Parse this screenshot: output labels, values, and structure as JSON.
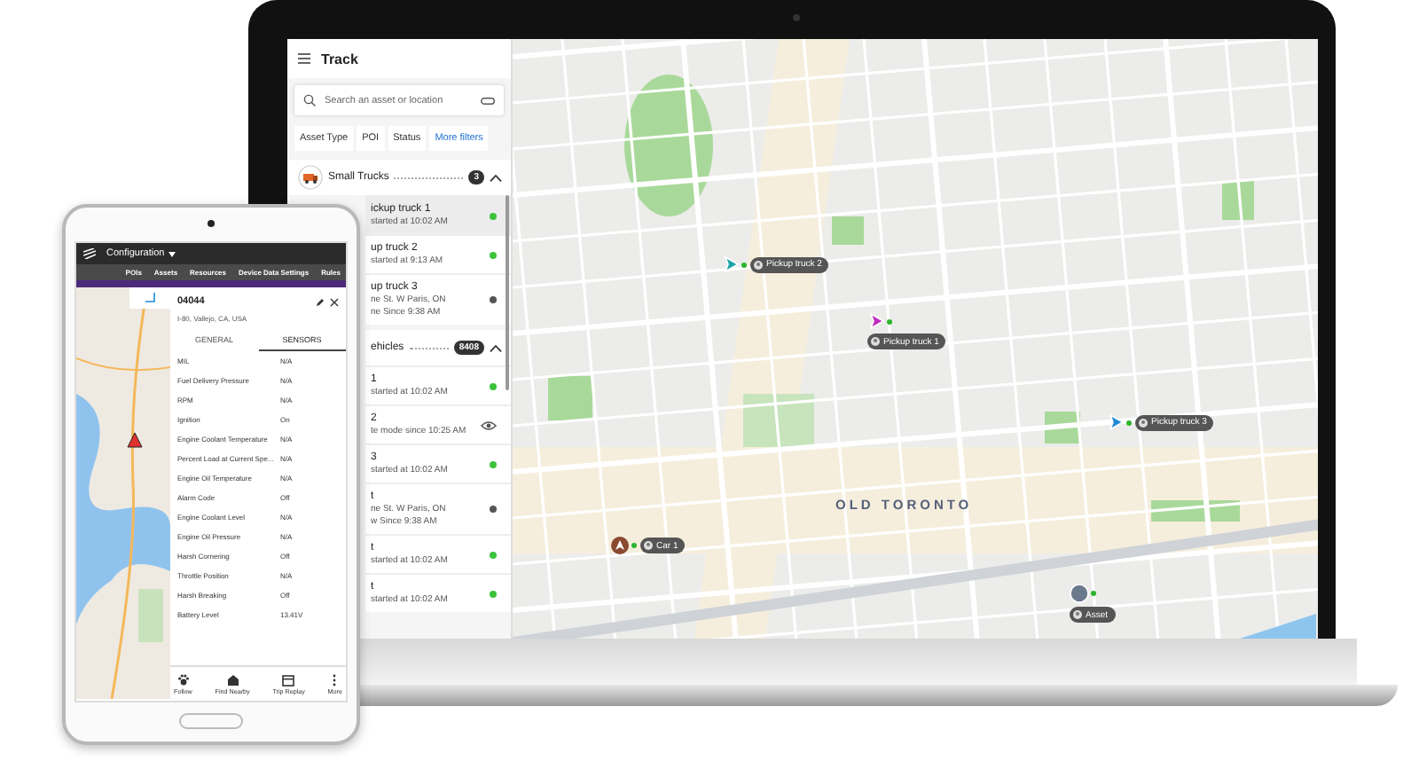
{
  "laptop": {
    "app_title": "Track",
    "search": {
      "placeholder": "Search an asset or location"
    },
    "filters": [
      {
        "label": "Asset Type",
        "kind": "chip"
      },
      {
        "label": "POI",
        "kind": "chip"
      },
      {
        "label": "Status",
        "kind": "chip"
      },
      {
        "label": "More filters",
        "kind": "link"
      }
    ],
    "groups": [
      {
        "name": "Small Trucks",
        "count": "3",
        "expanded": true,
        "items": [
          {
            "title": "ickup truck 1",
            "lines": [
              "started at 10:02 AM"
            ],
            "kind": "active",
            "selected": true
          },
          {
            "title": "up truck 2",
            "lines": [
              "started at 9:13 AM"
            ],
            "kind": "active",
            "selected": false
          },
          {
            "title": "up truck 3",
            "lines": [
              "ne St. W Paris, ON",
              "ne Since 9:38 AM"
            ],
            "kind": "idle",
            "selected": false
          }
        ]
      },
      {
        "name": "ehicles",
        "count": "8408",
        "expanded": true,
        "items": [
          {
            "title": "1",
            "lines": [
              "started at 10:02 AM"
            ],
            "kind": "active",
            "selected": false
          },
          {
            "title": "2",
            "lines": [
              "te mode since 10:25 AM"
            ],
            "kind": "private",
            "selected": false
          },
          {
            "title": "3",
            "lines": [
              "started at 10:02 AM"
            ],
            "kind": "active",
            "selected": false
          },
          {
            "title": "t",
            "lines": [
              "ne St. W Paris, ON",
              "w Since 9:38 AM"
            ],
            "kind": "idle",
            "selected": false
          },
          {
            "title": "t",
            "lines": [
              "started at 10:02 AM"
            ],
            "kind": "active",
            "selected": false
          },
          {
            "title": "t",
            "lines": [
              "started at 10:02 AM"
            ],
            "kind": "active",
            "selected": false
          }
        ]
      }
    ],
    "map": {
      "area_label": "OLD TORONTO",
      "markers": [
        {
          "label": "Pickup truck 2",
          "kind": "truck",
          "color": "#1aa3a8"
        },
        {
          "label": "Pickup truck 1",
          "kind": "truck",
          "color": "#c02cc0"
        },
        {
          "label": "Pickup truck 3",
          "kind": "truck",
          "color": "#1f8ad6"
        },
        {
          "label": "Car 1",
          "kind": "car",
          "color": "#8b4a2f"
        },
        {
          "label": "Asset",
          "kind": "asset",
          "color": "#6a7a8c"
        }
      ]
    }
  },
  "tablet": {
    "app_title": "Configuration",
    "nav": [
      "POIs",
      "Assets",
      "Resources",
      "Device Data Settings",
      "Rules"
    ],
    "asset": {
      "id": "04044",
      "address": "I-80, Vallejo, CA, USA",
      "tabs": [
        {
          "label": "GENERAL",
          "selected": false
        },
        {
          "label": "SENSORS",
          "selected": true
        }
      ],
      "sensors": [
        {
          "name": "MIL",
          "value": "N/A"
        },
        {
          "name": "Fuel Delivery Pressure",
          "value": "N/A"
        },
        {
          "name": "RPM",
          "value": "N/A"
        },
        {
          "name": "Ignition",
          "value": "On"
        },
        {
          "name": "Engine Coolant Temperature",
          "value": "N/A"
        },
        {
          "name": "Percent Load at Current Spe...",
          "value": "N/A"
        },
        {
          "name": "Engine Oil Temperature",
          "value": "N/A"
        },
        {
          "name": "Alarm Code",
          "value": "Off"
        },
        {
          "name": "Engine Coolant Level",
          "value": "N/A"
        },
        {
          "name": "Engine Oil Pressure",
          "value": "N/A"
        },
        {
          "name": "Harsh Cornering",
          "value": "Off"
        },
        {
          "name": "Throttle Position",
          "value": "N/A"
        },
        {
          "name": "Harsh Breaking",
          "value": "Off"
        },
        {
          "name": "Battery Level",
          "value": "13.41V"
        }
      ]
    },
    "actions": [
      {
        "label": "Follow",
        "kind": "follow"
      },
      {
        "label": "Find Nearby",
        "kind": "nearby"
      },
      {
        "label": "Trip Replay",
        "kind": "replay"
      },
      {
        "label": "More",
        "kind": "more"
      }
    ]
  }
}
